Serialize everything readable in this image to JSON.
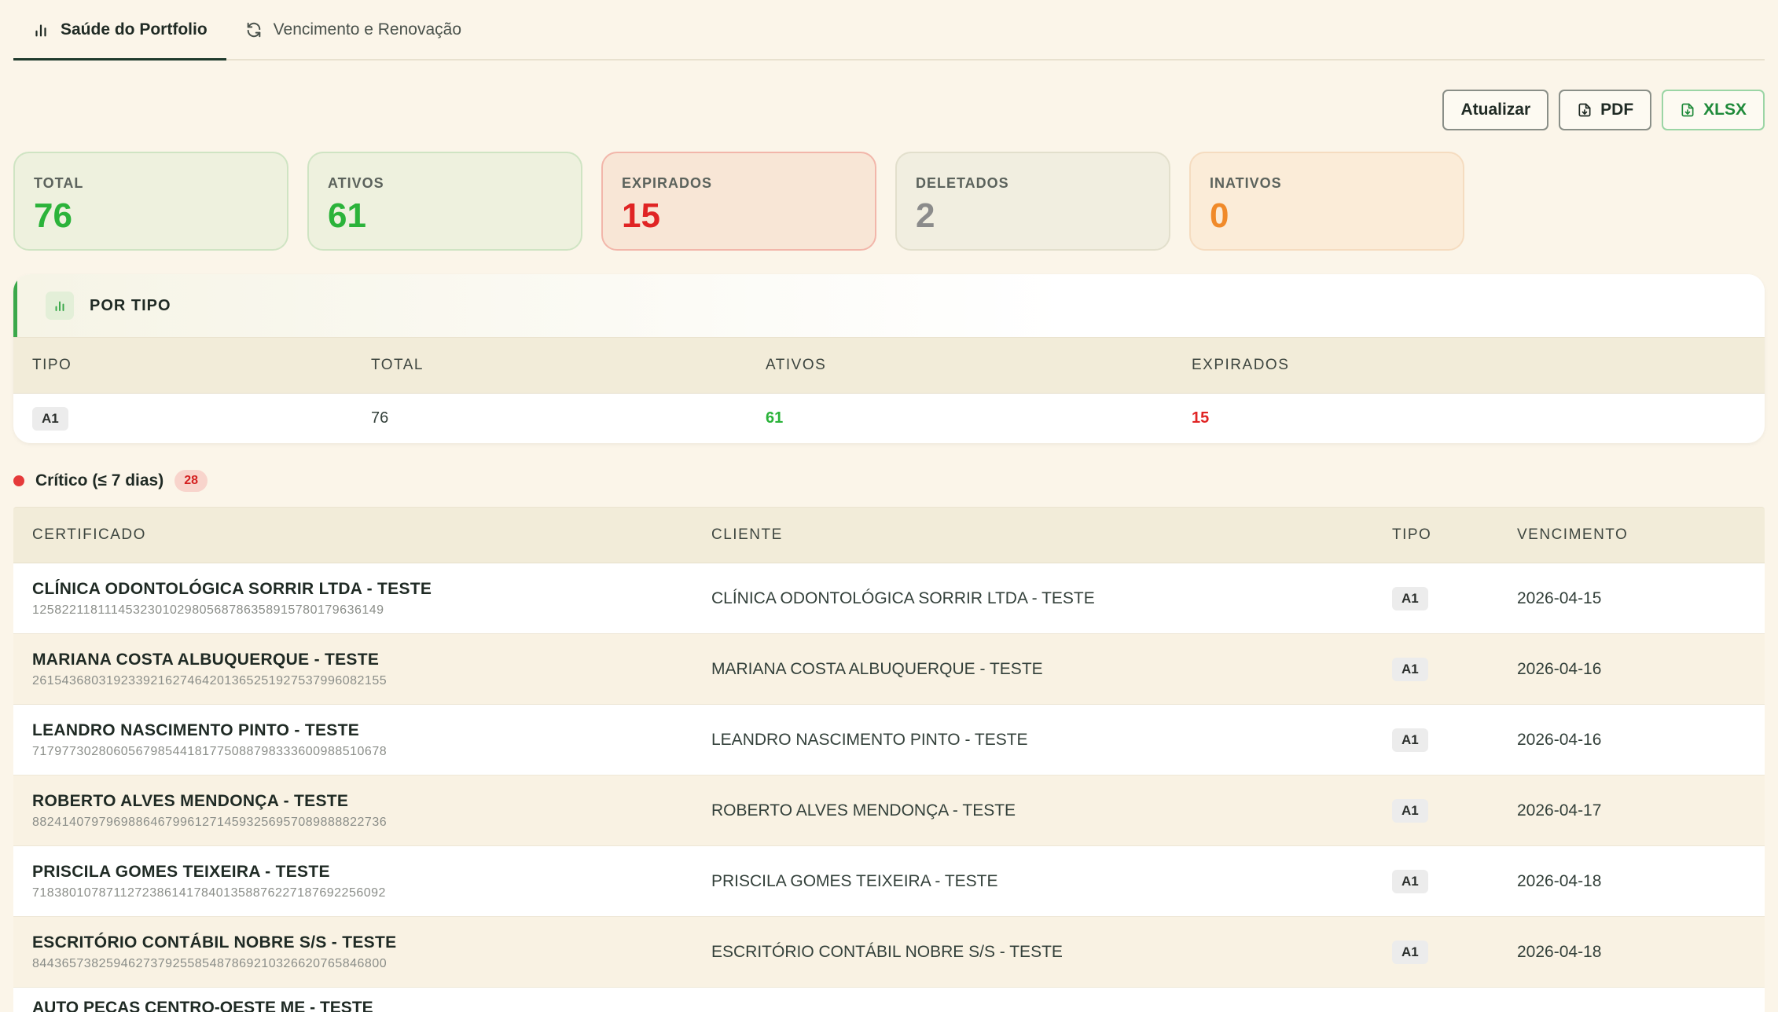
{
  "tabs": [
    {
      "label": "Saúde do Portfolio",
      "icon": "bar-chart-icon",
      "active": true
    },
    {
      "label": "Vencimento e Renovação",
      "icon": "refresh-icon",
      "active": false
    }
  ],
  "toolbar": {
    "refresh_label": "Atualizar",
    "pdf_label": "PDF",
    "xlsx_label": "XLSX"
  },
  "stats": [
    {
      "label": "TOTAL",
      "value": "76"
    },
    {
      "label": "ATIVOS",
      "value": "61"
    },
    {
      "label": "EXPIRADOS",
      "value": "15"
    },
    {
      "label": "DELETADOS",
      "value": "2"
    },
    {
      "label": "INATIVOS",
      "value": "0"
    }
  ],
  "por_tipo": {
    "title": "POR TIPO",
    "columns": [
      "TIPO",
      "TOTAL",
      "ATIVOS",
      "EXPIRADOS"
    ],
    "rows": [
      {
        "tipo": "A1",
        "total": "76",
        "ativos": "61",
        "expirados": "15"
      }
    ]
  },
  "critico": {
    "title": "Crítico (≤ 7 dias)",
    "count": "28",
    "columns": [
      "CERTIFICADO",
      "CLIENTE",
      "TIPO",
      "VENCIMENTO"
    ],
    "rows": [
      {
        "name": "CLÍNICA ODONTOLÓGICA SORRIR LTDA - TESTE",
        "serial": "125822118111453230102980568786358915780179636149",
        "cliente": "CLÍNICA ODONTOLÓGICA SORRIR LTDA - TESTE",
        "tipo": "A1",
        "vencimento": "2026-04-15"
      },
      {
        "name": "MARIANA COSTA ALBUQUERQUE - TESTE",
        "serial": "261543680319233921627464201365251927537996082155",
        "cliente": "MARIANA COSTA ALBUQUERQUE - TESTE",
        "tipo": "A1",
        "vencimento": "2026-04-16"
      },
      {
        "name": "LEANDRO NASCIMENTO PINTO - TESTE",
        "serial": "717977302806056798544181775088798333600988510678",
        "cliente": "LEANDRO NASCIMENTO PINTO - TESTE",
        "tipo": "A1",
        "vencimento": "2026-04-16"
      },
      {
        "name": "ROBERTO ALVES MENDONÇA - TESTE",
        "serial": "882414079796988646799612714593256957089888822736",
        "cliente": "ROBERTO ALVES MENDONÇA - TESTE",
        "tipo": "A1",
        "vencimento": "2026-04-17"
      },
      {
        "name": "PRISCILA GOMES TEIXEIRA - TESTE",
        "serial": "718380107871127238614178401358876227187692256092",
        "cliente": "PRISCILA GOMES TEIXEIRA - TESTE",
        "tipo": "A1",
        "vencimento": "2026-04-18"
      },
      {
        "name": "ESCRITÓRIO CONTÁBIL NOBRE S/S - TESTE",
        "serial": "844365738259462737925585487869210326620765846800",
        "cliente": "ESCRITÓRIO CONTÁBIL NOBRE S/S - TESTE",
        "tipo": "A1",
        "vencimento": "2026-04-18"
      }
    ],
    "partial_row_name": "AUTO PEÇAS CENTRO-OESTE ME - TESTE"
  }
}
